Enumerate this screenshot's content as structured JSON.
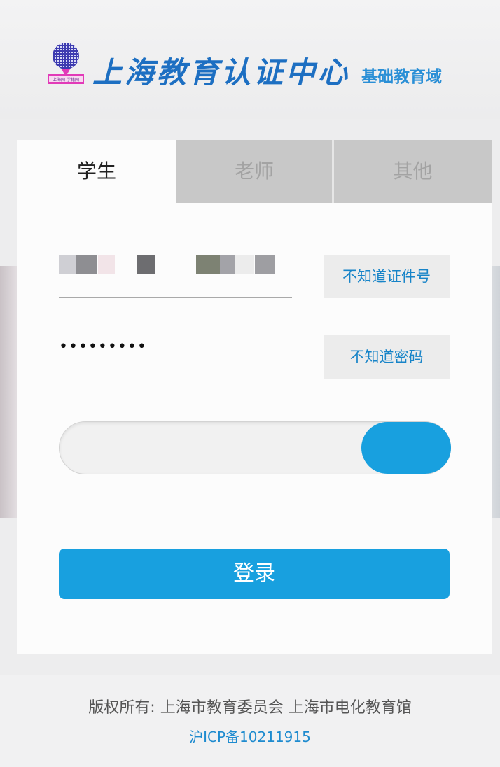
{
  "header": {
    "logo_caption": "上海网 学籍网",
    "title": "上海教育认证中心",
    "subtitle": "基础教育域"
  },
  "tabs": [
    {
      "label": "学生",
      "active": true
    },
    {
      "label": "老师",
      "active": false
    },
    {
      "label": "其他",
      "active": false
    }
  ],
  "form": {
    "id_value_masked": true,
    "password_value": "•••••••••",
    "forgot_id_label": "不知道证件号",
    "forgot_password_label": "不知道密码",
    "login_label": "登录"
  },
  "footer": {
    "copyright": "版权所有: 上海市教育委员会 上海市电化教育馆",
    "icp": "沪ICP备10211915"
  },
  "colors": {
    "accent": "#18a0df",
    "link": "#1784c8",
    "tab_inactive": "#c8c8c8",
    "logo_blue": "#1d6fc2"
  }
}
